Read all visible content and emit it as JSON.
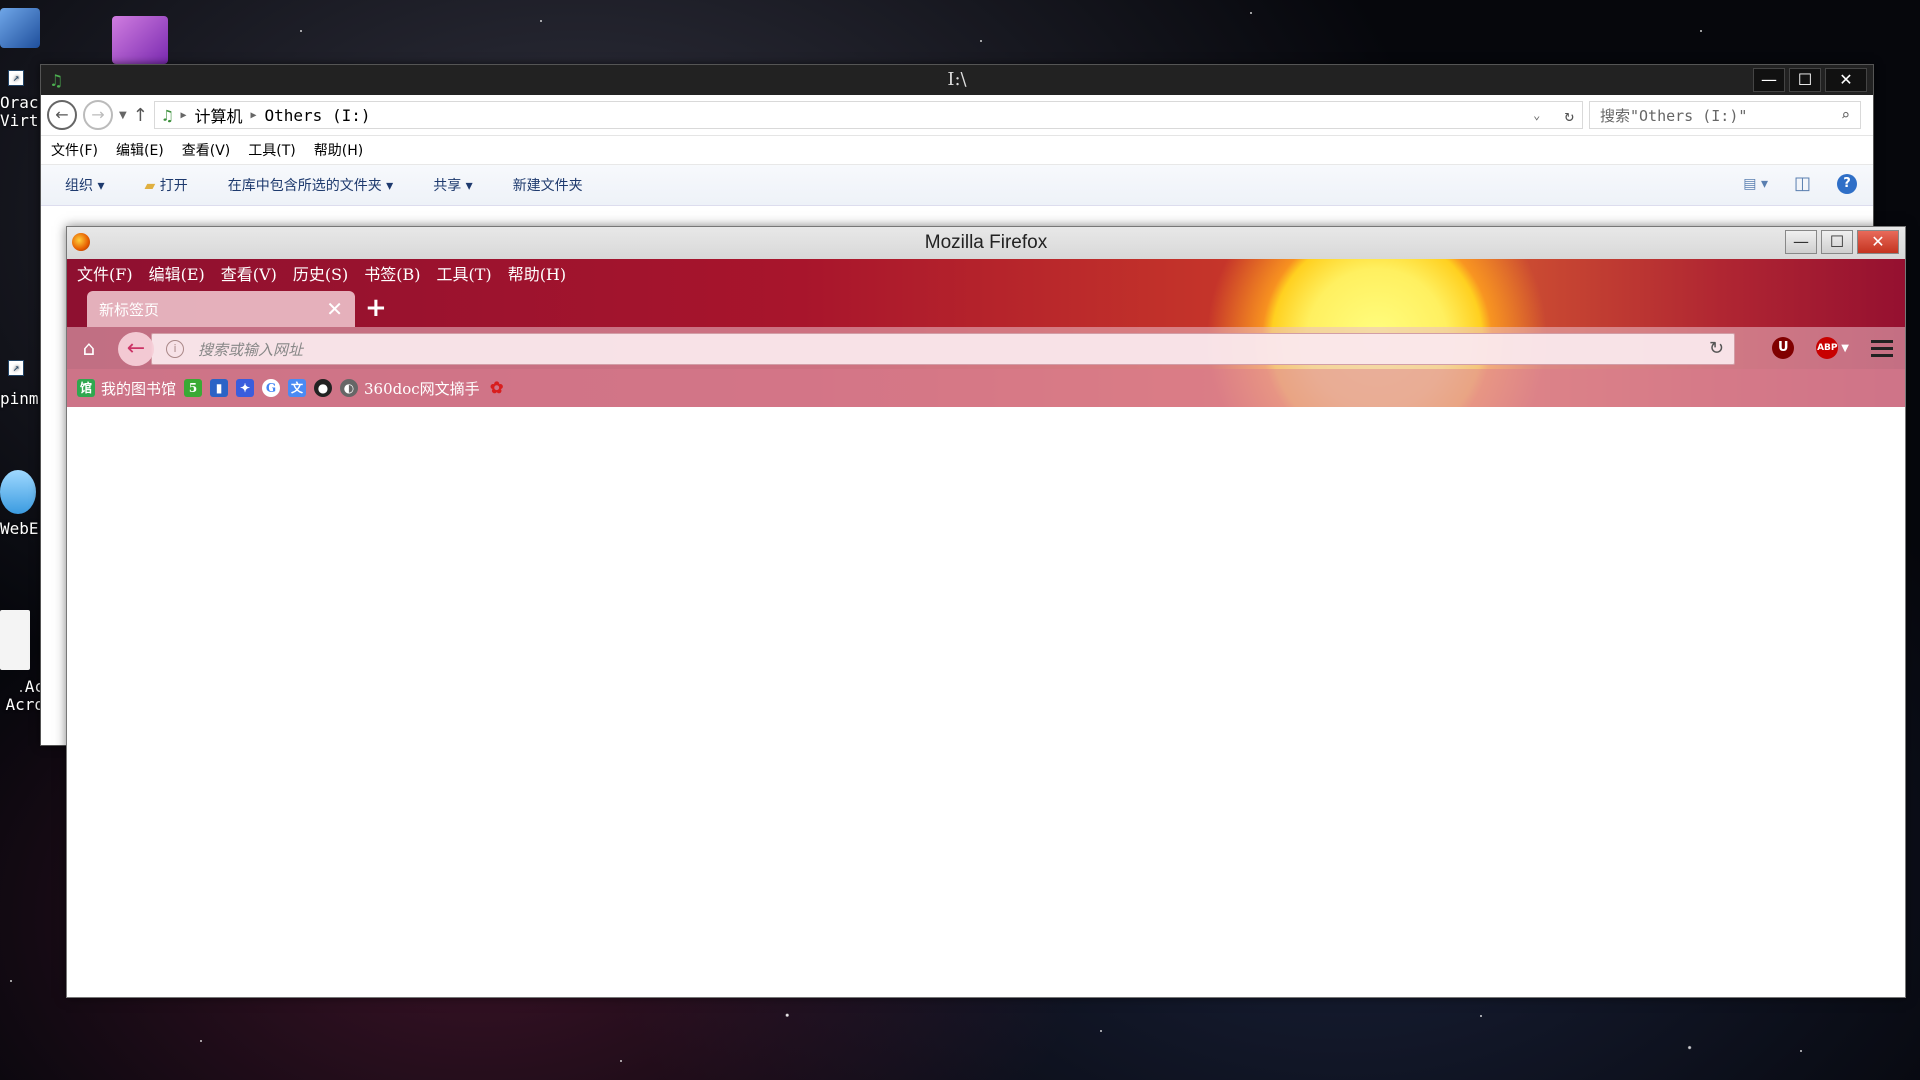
{
  "desktop": {
    "icons": [
      {
        "label": "Orac\nVirt"
      },
      {
        "label": "pinm"
      },
      {
        "label": "WebE"
      },
      {
        "label": "Ac\nAcro"
      }
    ]
  },
  "explorer": {
    "title": "I:\\",
    "address": {
      "computer": "计算机",
      "drive": "Others (I:)"
    },
    "search_placeholder": "搜索\"Others (I:)\"",
    "menu": [
      "文件(F)",
      "编辑(E)",
      "查看(V)",
      "工具(T)",
      "帮助(H)"
    ],
    "toolbar": {
      "organize": "组织",
      "open": "打开",
      "include_library": "在库中包含所选的文件夹",
      "share": "共享",
      "new_folder": "新建文件夹"
    },
    "controls": {
      "minimize": "—",
      "maximize": "☐",
      "close": "✕"
    }
  },
  "firefox": {
    "title": "Mozilla Firefox",
    "menu": [
      "文件(F)",
      "编辑(E)",
      "查看(V)",
      "历史(S)",
      "书签(B)",
      "工具(T)",
      "帮助(H)"
    ],
    "tab": {
      "label": "新标签页"
    },
    "urlbar_placeholder": "搜索或输入网址",
    "bookmarks": [
      {
        "label": "我的图书馆",
        "icon": "library-icon",
        "color": "#2fa84f"
      },
      {
        "label": "",
        "icon": "5-icon",
        "color": "#3aaa35"
      },
      {
        "label": "",
        "icon": "bookmark-blue-icon",
        "color": "#2b63c6"
      },
      {
        "label": "",
        "icon": "baidu-icon",
        "color": "#3a5ddd"
      },
      {
        "label": "",
        "icon": "google-icon",
        "color": "#ffffff"
      },
      {
        "label": "",
        "icon": "translate-icon",
        "color": "#4a8af4"
      },
      {
        "label": "",
        "icon": "github-icon",
        "color": "#222222"
      },
      {
        "label": "360doc网文摘手",
        "icon": "360doc-icon",
        "color": "#666666"
      },
      {
        "label": "",
        "icon": "red-flower-icon",
        "color": "#d81e1e"
      }
    ],
    "extensions": {
      "ublock": "U",
      "abp": "ABP"
    }
  }
}
